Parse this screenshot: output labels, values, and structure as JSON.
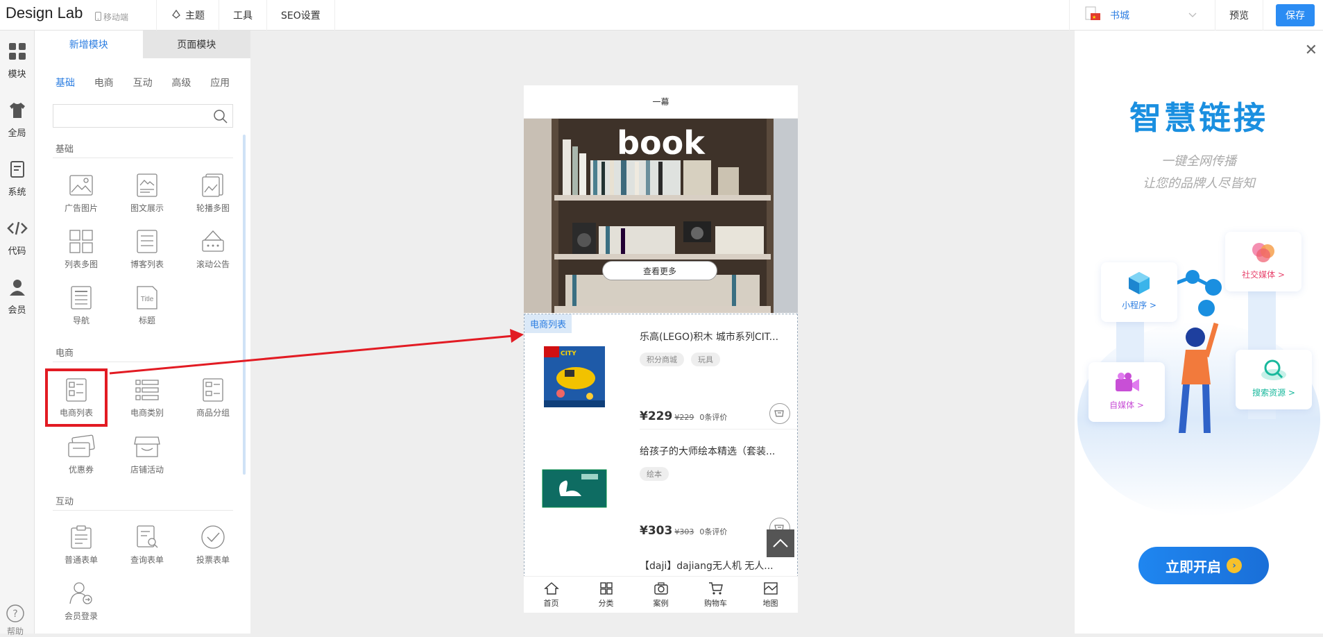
{
  "header": {
    "logo": "Design Lab",
    "mobile_label": "移动端",
    "nav": [
      {
        "label": "主题"
      },
      {
        "label": "工具"
      },
      {
        "label": "SEO设置"
      }
    ],
    "lang_label": "书城",
    "preview_label": "预览",
    "save_label": "保存"
  },
  "rail": {
    "items": [
      {
        "label": "模块"
      },
      {
        "label": "全局"
      },
      {
        "label": "系统"
      },
      {
        "label": "代码"
      },
      {
        "label": "会员"
      }
    ],
    "help_label": "帮助"
  },
  "panel": {
    "tabs": [
      "新增模块",
      "页面模块"
    ],
    "categories": [
      "基础",
      "电商",
      "互动",
      "高级",
      "应用"
    ],
    "search_placeholder": "",
    "sections": [
      {
        "title": "基础",
        "modules": [
          "广告图片",
          "图文展示",
          "轮播多图",
          "列表多图",
          "博客列表",
          "滚动公告",
          "导航",
          "标题"
        ]
      },
      {
        "title": "电商",
        "modules": [
          "电商列表",
          "电商类别",
          "商品分组",
          "优惠券",
          "店铺活动"
        ]
      },
      {
        "title": "互动",
        "modules": [
          "普通表单",
          "查询表单",
          "投票表单",
          "会员登录"
        ]
      }
    ]
  },
  "phone": {
    "title": "一幕",
    "banner_text": "book",
    "banner_button": "查看更多",
    "ecom_tag": "电商列表",
    "products": [
      {
        "name": "乐高(LEGO)积木 城市系列CIT...",
        "tags": [
          "积分商城",
          "玩具"
        ],
        "price": "¥229",
        "original_price": "¥229",
        "reviews": "0条评价"
      },
      {
        "name": "给孩子的大师绘本精选（套装...",
        "tags": [
          "绘本"
        ],
        "price": "¥303",
        "original_price": "¥303",
        "reviews": "0条评价"
      },
      {
        "name": "【daji】dajiang无人机 无人..."
      }
    ],
    "tabbar": [
      "首页",
      "分类",
      "案例",
      "购物车",
      "地图"
    ]
  },
  "promo": {
    "title": "智慧链接",
    "sub1": "一键全网传播",
    "sub2": "让您的品牌人尽皆知",
    "cards": [
      "小程序 >",
      "社交媒体 >",
      "自媒体 >",
      "搜索资源 >"
    ],
    "cta": "立即开启"
  },
  "colors": {
    "accent": "#2b7de1",
    "highlight": "#e21b23",
    "save": "#2b8cf3"
  }
}
